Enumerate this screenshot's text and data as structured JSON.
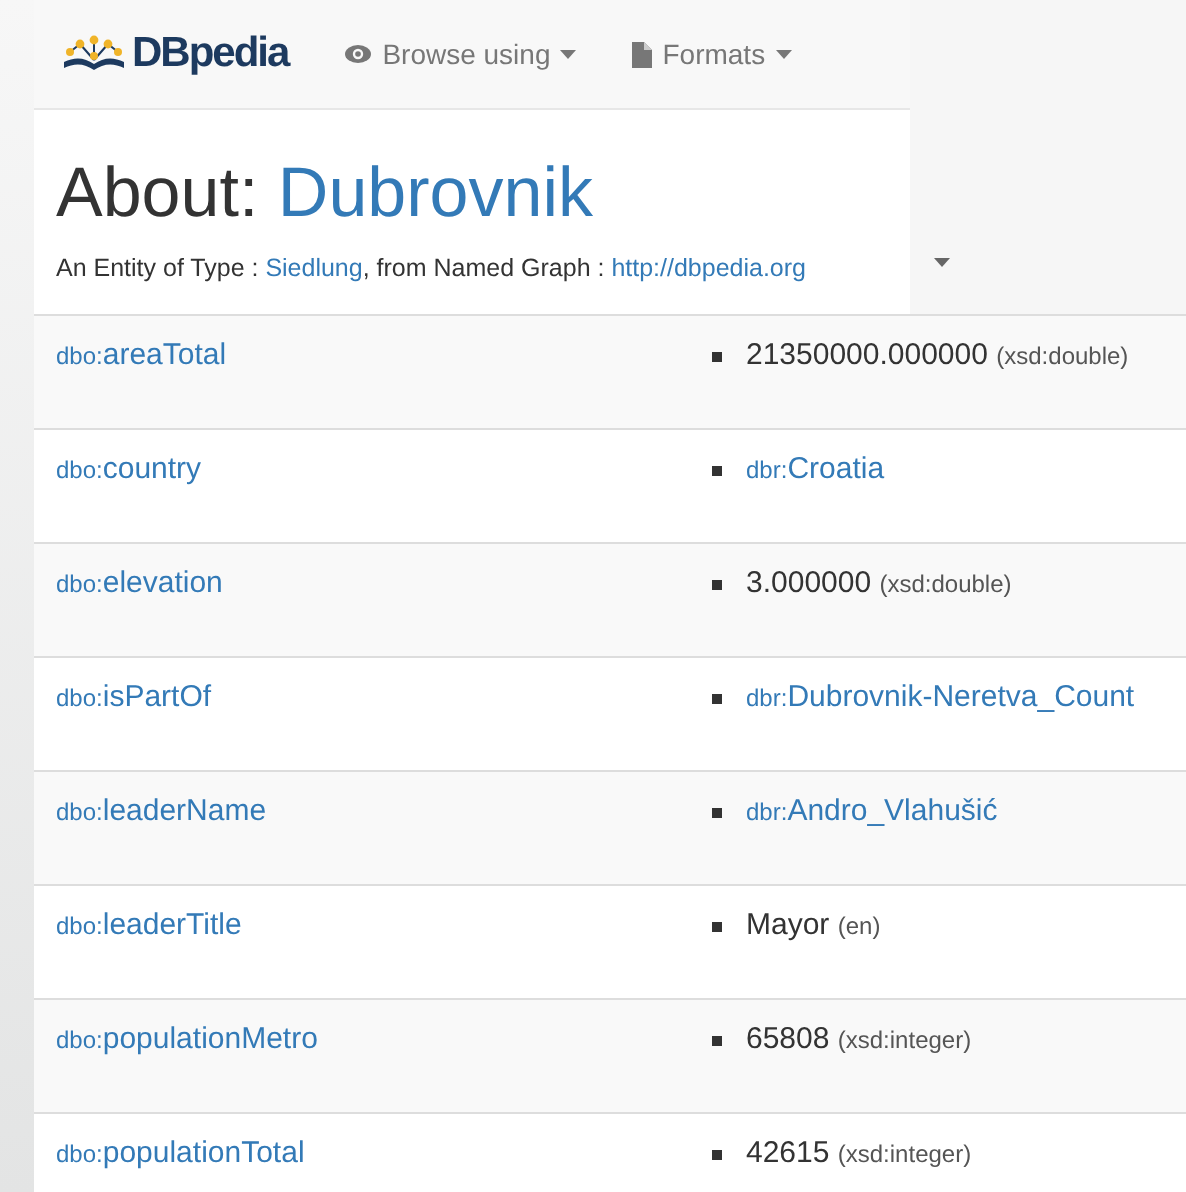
{
  "navbar": {
    "brand": "DBpedia",
    "menus": [
      {
        "label": "Browse using",
        "kind": "view"
      },
      {
        "label": "Formats",
        "kind": "format"
      }
    ]
  },
  "title": {
    "prefix": "About: ",
    "entity": "Dubrovnik"
  },
  "subtitle": {
    "lead": "An Entity of Type : ",
    "type": "Siedlung",
    "middle": ", from Named Graph : ",
    "graph": "http://dbpedia.org"
  },
  "rows": [
    {
      "prefix": "dbo:",
      "property": "areaTotal",
      "kind": "literal",
      "value": "21350000.000000",
      "datatype": "(xsd:double)"
    },
    {
      "prefix": "dbo:",
      "property": "country",
      "kind": "link",
      "value_prefix": "dbr:",
      "value": "Croatia"
    },
    {
      "prefix": "dbo:",
      "property": "elevation",
      "kind": "literal",
      "value": "3.000000",
      "datatype": "(xsd:double)"
    },
    {
      "prefix": "dbo:",
      "property": "isPartOf",
      "kind": "link",
      "value_prefix": "dbr:",
      "value": "Dubrovnik-Neretva_Count"
    },
    {
      "prefix": "dbo:",
      "property": "leaderName",
      "kind": "link",
      "value_prefix": "dbr:",
      "value": "Andro_Vlahušić"
    },
    {
      "prefix": "dbo:",
      "property": "leaderTitle",
      "kind": "literal",
      "value": "Mayor",
      "datatype": "(en)"
    },
    {
      "prefix": "dbo:",
      "property": "populationMetro",
      "kind": "literal",
      "value": "65808",
      "datatype": "(xsd:integer)"
    },
    {
      "prefix": "dbo:",
      "property": "populationTotal",
      "kind": "literal",
      "value": "42615",
      "datatype": "(xsd:integer)"
    }
  ]
}
